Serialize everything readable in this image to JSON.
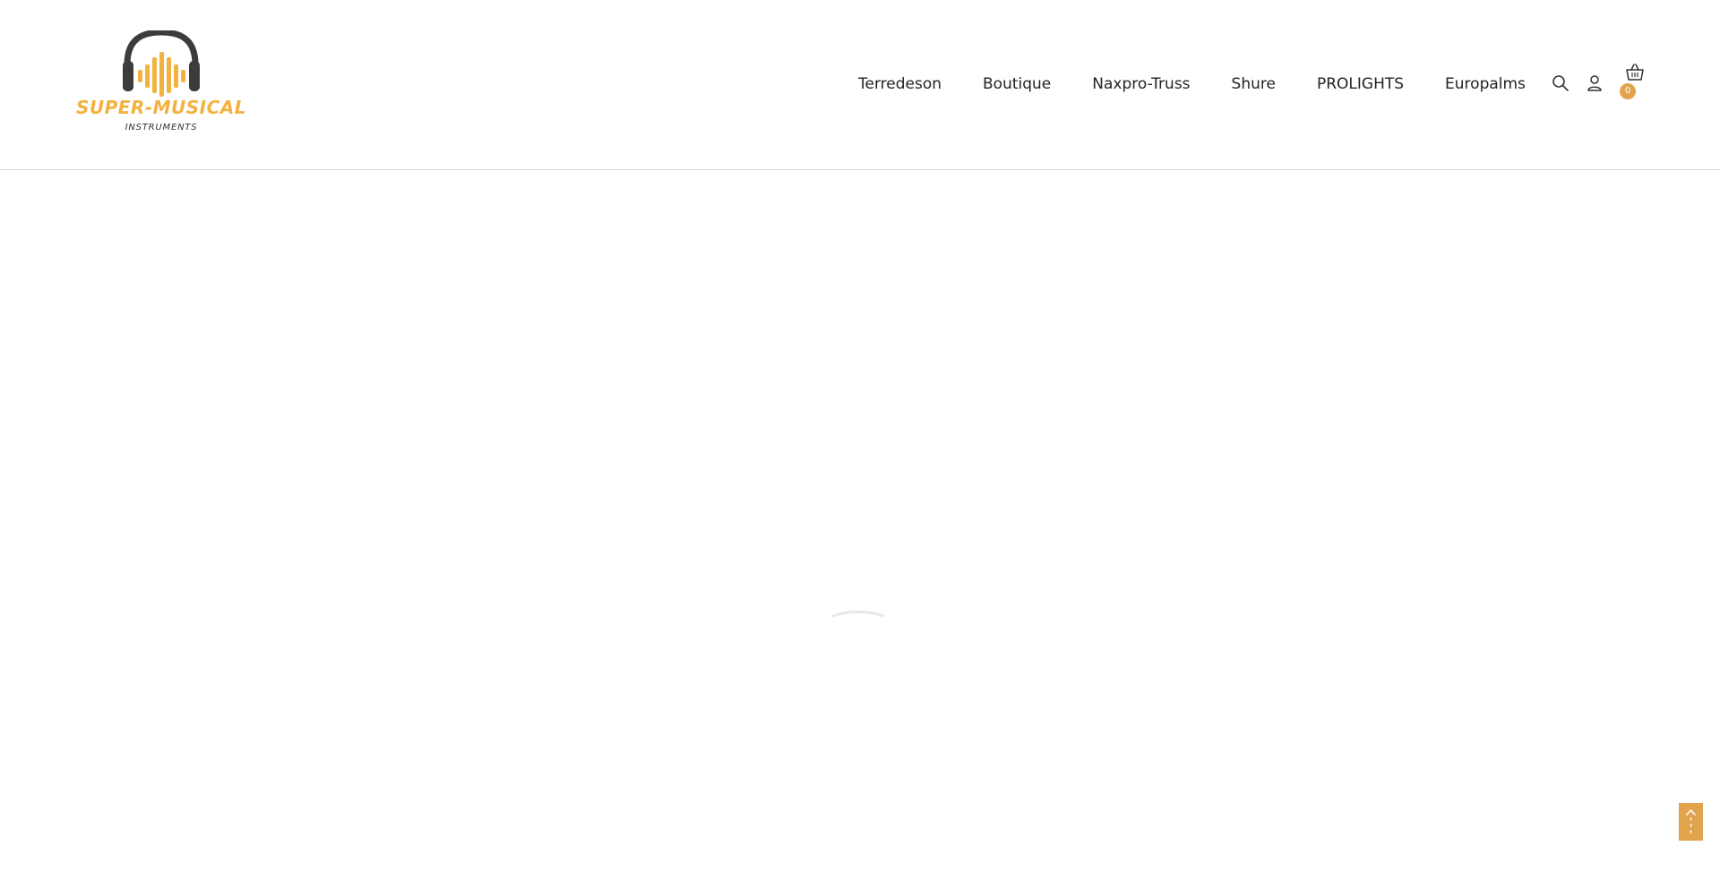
{
  "brand": {
    "name": "SUPER-MUSICAL",
    "tagline": "INSTRUMENTS",
    "logo_icon": "headphones-equalizer-icon",
    "colors": {
      "accent": "#f3b23f",
      "badge": "#e2a34d",
      "headphones": "#3c3c3c"
    }
  },
  "nav": {
    "items": [
      {
        "label": "Terredeson"
      },
      {
        "label": "Boutique"
      },
      {
        "label": "Naxpro-Truss"
      },
      {
        "label": "Shure"
      },
      {
        "label": "PROLIGHTS"
      },
      {
        "label": "Europalms"
      }
    ]
  },
  "header_icons": {
    "search": "search-icon",
    "account": "user-icon",
    "cart": "basket-icon",
    "cart_count": "0"
  },
  "scroll_top": {
    "icon": "arrow-up-icon"
  }
}
